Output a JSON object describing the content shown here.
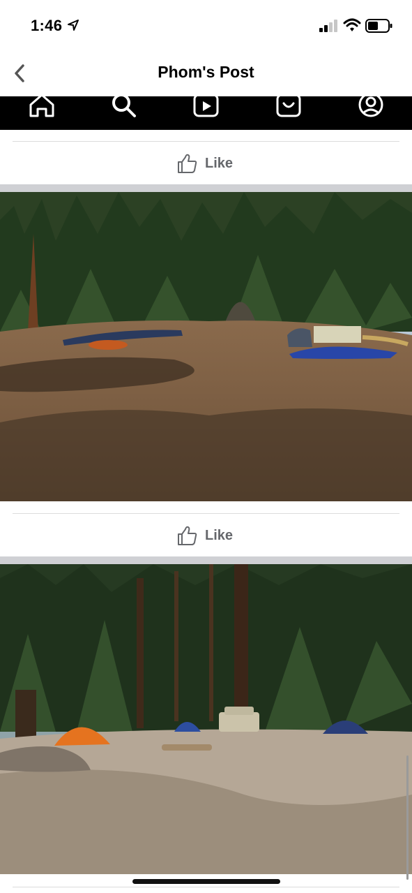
{
  "status_bar": {
    "time": "1:46",
    "battery_level": 0.5
  },
  "nav": {
    "title": "Phom's Post",
    "back_icon": "chevron-left-icon"
  },
  "app_bar": {
    "background": "#000000",
    "icons": [
      "home-icon",
      "search-icon",
      "video-icon",
      "shop-icon",
      "profile-icon"
    ]
  },
  "posts": [
    {
      "like_label": "Like",
      "photo": "forest clearing with dirt ground, trees, and tarps"
    },
    {
      "like_label": "Like",
      "photo": "campsite with orange tent, blue tents, and a pickup truck in forest"
    }
  ],
  "colors": {
    "like_text": "#65676b",
    "separator": "#cfd0d4"
  }
}
